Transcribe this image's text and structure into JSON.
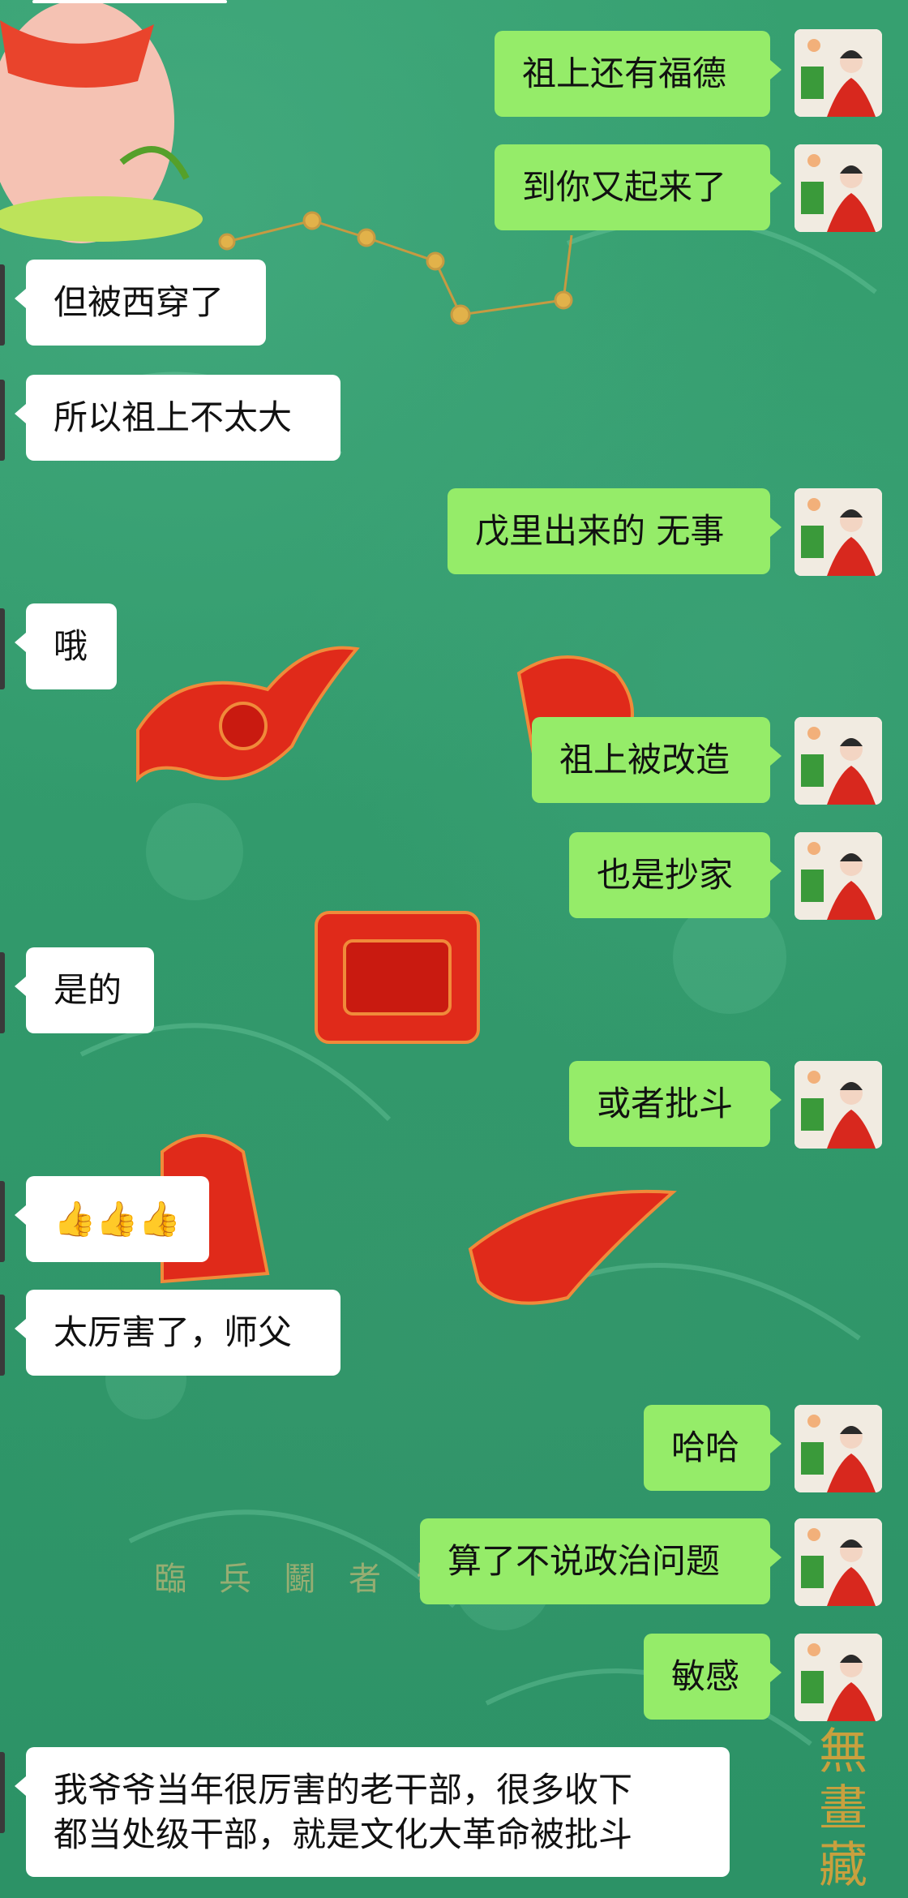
{
  "messages": [
    {
      "side": "right",
      "text": "祖上还有福德"
    },
    {
      "side": "right",
      "text": "到你又起来了"
    },
    {
      "side": "left",
      "text": "但被西穿了"
    },
    {
      "side": "left",
      "text": "所以祖上不太大"
    },
    {
      "side": "right",
      "text": "戊里出来的 无事"
    },
    {
      "side": "left",
      "text": "哦"
    },
    {
      "side": "right",
      "text": "祖上被改造"
    },
    {
      "side": "right",
      "text": "也是抄家"
    },
    {
      "side": "left",
      "text": "是的"
    },
    {
      "side": "right",
      "text": "或者批斗"
    },
    {
      "side": "left",
      "text": "👍👍👍"
    },
    {
      "side": "left",
      "text": "太厉害了，师父"
    },
    {
      "side": "right",
      "text": "哈哈"
    },
    {
      "side": "right",
      "text": "算了不说政治问题"
    },
    {
      "side": "right",
      "text": "敏感"
    },
    {
      "side": "left",
      "lines": [
        "我爷爷当年很厉害的老干部，很多收下",
        "都当处级干部，就是文化大革命被批斗"
      ]
    }
  ],
  "background": {
    "watermark": "臨 兵 鬭 者 皆",
    "corner_text": "無 畫 藏",
    "colors": {
      "base": "#2f9a6c",
      "seal": "#e02a1a",
      "gold": "#d8a33a"
    }
  },
  "icons": {
    "avatar": "avatar-woman-red-dress-icon",
    "thumbs": "thumbs-up-icon"
  }
}
